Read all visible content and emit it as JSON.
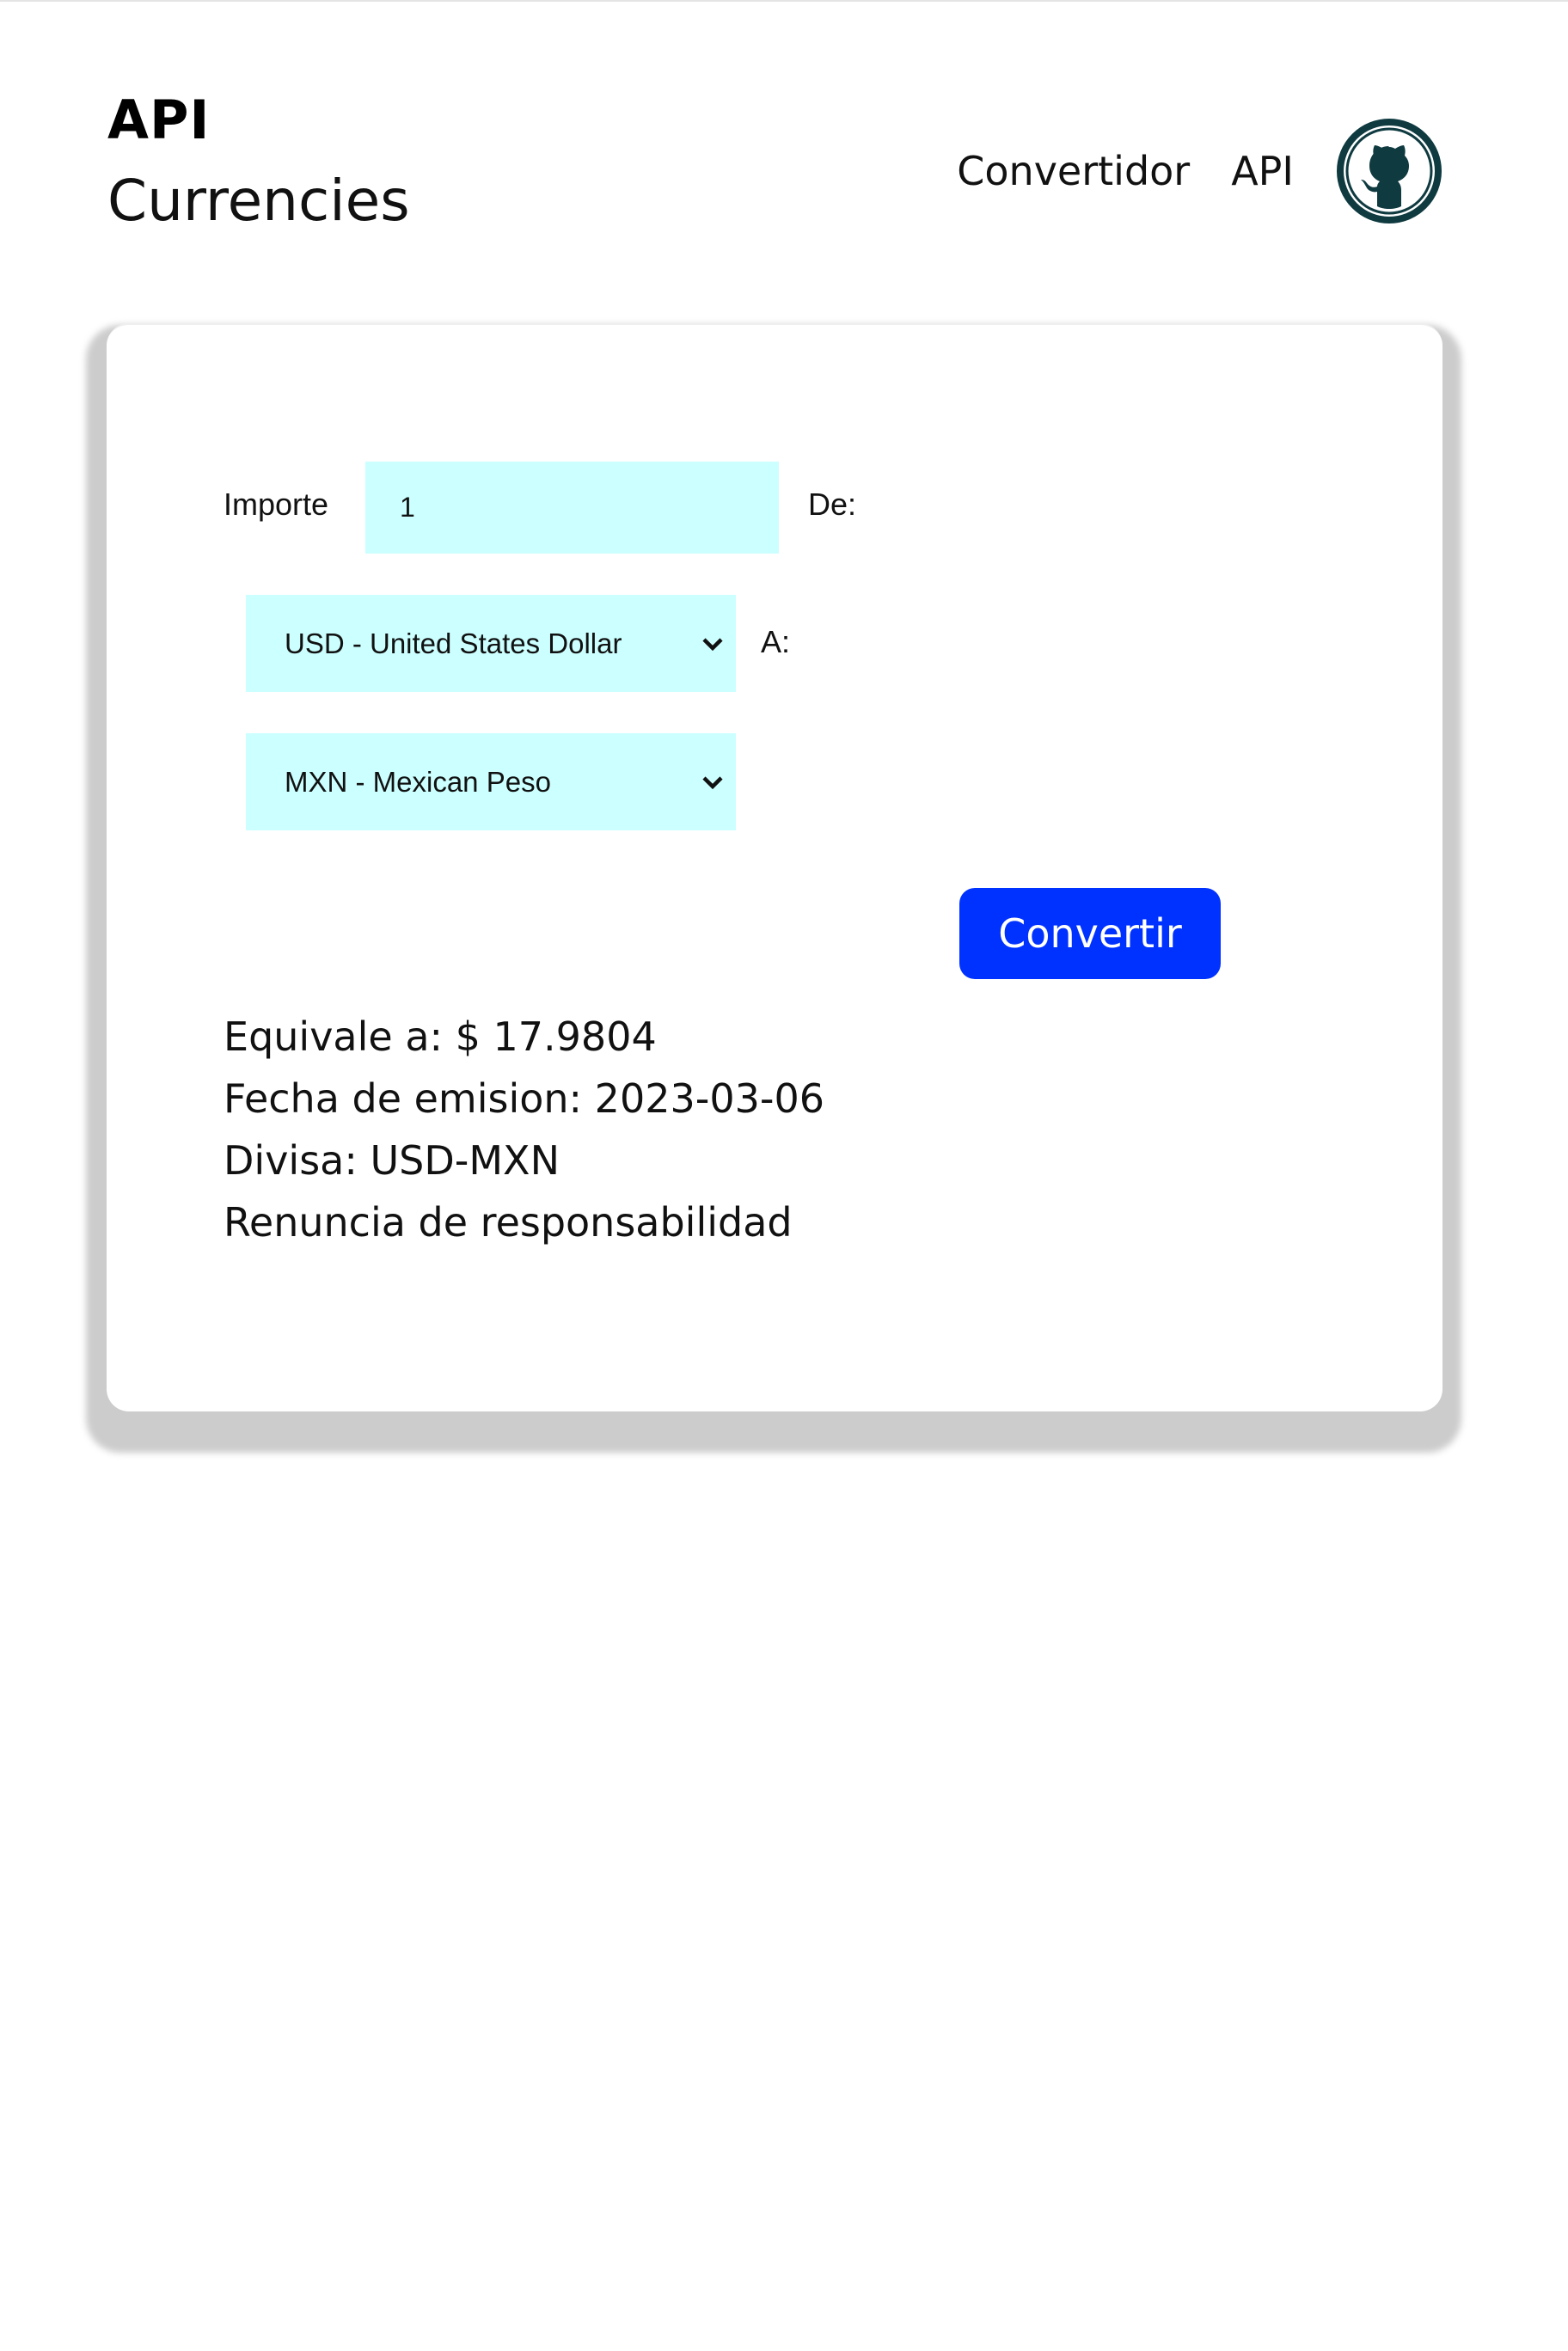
{
  "brand": {
    "title": "API",
    "subtitle": "Currencies"
  },
  "nav": {
    "items": [
      {
        "label": "Convertidor"
      },
      {
        "label": "API"
      }
    ],
    "github_icon": "github-icon"
  },
  "form": {
    "amount_label": "Importe",
    "amount_value": "1",
    "from_label": "De:",
    "from_selected": "USD - United States Dollar",
    "to_label": "A:",
    "to_selected": "MXN - Mexican Peso",
    "submit_label": "Convertir"
  },
  "result": {
    "equivalent": "Equivale a: $ 17.9804",
    "issue_date": "Fecha de emision: 2023-03-06",
    "currency_pair": "Divisa: USD-MXN",
    "disclaimer": "Renuncia de responsabilidad"
  },
  "colors": {
    "field_bg": "#ccffff",
    "button_bg": "#0032ff",
    "github_icon": "#0e3a40"
  }
}
